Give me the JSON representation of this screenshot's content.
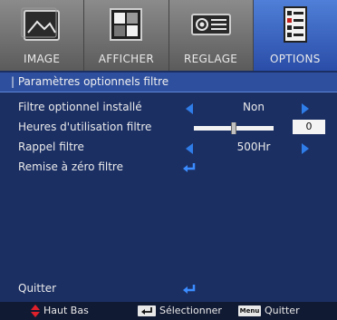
{
  "tabs": [
    {
      "label": "IMAGE",
      "icon": "image-icon",
      "active": false
    },
    {
      "label": "AFFICHER",
      "icon": "display-icon",
      "active": false
    },
    {
      "label": "REGLAGE",
      "icon": "projector-icon",
      "active": false
    },
    {
      "label": "OPTIONS",
      "icon": "options-icon",
      "active": true
    }
  ],
  "breadcrumb": "| Paramètres optionnels filtre",
  "rows": {
    "filter_installed": {
      "label": "Filtre optionnel installé",
      "value": "Non"
    },
    "filter_hours": {
      "label": "Heures d'utilisation filtre",
      "value": "0",
      "slider_fraction": 0.5
    },
    "filter_reminder": {
      "label": "Rappel filtre",
      "value": "500Hr"
    },
    "filter_reset": {
      "label": "Remise à zéro filtre"
    },
    "quit": {
      "label": "Quitter"
    }
  },
  "footer": {
    "nav": "Haut Bas",
    "select": "Sélectionner",
    "menu_key": "Menu",
    "quit": "Quitter"
  },
  "colors": {
    "background": "#1b2f63",
    "active_tab": "#3d6bc8",
    "arrow": "#2f7de9",
    "enter_icon": "#3b8cff",
    "nav_icon": "#e0202a"
  }
}
